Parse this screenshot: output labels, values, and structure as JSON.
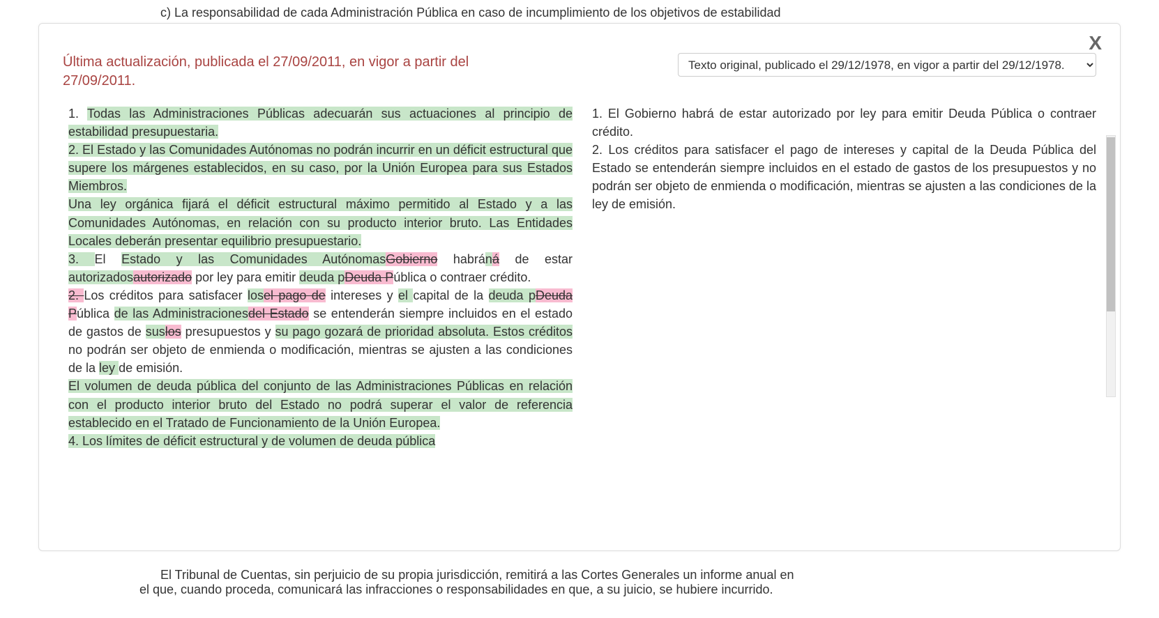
{
  "background": {
    "top_fragment": "c) La responsabilidad de cada Administración Pública en caso de incumplimiento de los objetivos de estabilidad",
    "bottom_fragment_line1": "El Tribunal de Cuentas, sin perjuicio de su propia jurisdicción, remitirá a las Cortes Generales un informe anual en",
    "bottom_fragment_line2": "el que, cuando proceda, comunicará las infracciones o responsabilidades en que, a su juicio, se hubiere incurrido."
  },
  "modal": {
    "close_label": "X",
    "left_title": "Última actualización, publicada el 27/09/2011, en vigor a partir del 27/09/2011.",
    "select_value": "Texto original, publicado el 29/12/1978, en vigor a partir del 29/12/1978.",
    "select_options": [
      "Texto original, publicado el 29/12/1978, en vigor a partir del 29/12/1978."
    ]
  },
  "left_panel": {
    "diff": [
      {
        "t": "plain",
        "v": "1. "
      },
      {
        "t": "ins",
        "v": "Todas las Administraciones Públicas adecuarán sus actuaciones al principio de estabilidad presupuestaria."
      },
      {
        "t": "br"
      },
      {
        "t": "ins",
        "v": "2. El Estado y las Comunidades Autónomas no podrán incurrir en un déficit estructural que supere los márgenes establecidos, en su caso, por la Unión Europea para sus Estados Miembros."
      },
      {
        "t": "br"
      },
      {
        "t": "ins",
        "v": "Una ley orgánica fijará el déficit estructural máximo permitido al Estado y a las Comunidades Autónomas, en relación con su producto interior bruto. Las Entidades Locales deberán presentar equilibrio presupuestario."
      },
      {
        "t": "br"
      },
      {
        "t": "ins",
        "v": "3. "
      },
      {
        "t": "plain",
        "v": "El "
      },
      {
        "t": "ins",
        "v": "Estado y las Comunidades Autónomas"
      },
      {
        "t": "del",
        "v": "Gobierno"
      },
      {
        "t": "plain",
        "v": " habrá"
      },
      {
        "t": "ins",
        "v": "n"
      },
      {
        "t": "del",
        "v": "á"
      },
      {
        "t": "plain",
        "v": " de estar "
      },
      {
        "t": "ins",
        "v": "autorizados"
      },
      {
        "t": "del",
        "v": "autorizado"
      },
      {
        "t": "plain",
        "v": " por ley para emitir "
      },
      {
        "t": "ins",
        "v": "deuda p"
      },
      {
        "t": "del",
        "v": "Deuda P"
      },
      {
        "t": "plain",
        "v": "ública o contraer crédito."
      },
      {
        "t": "br"
      },
      {
        "t": "del",
        "v": "2. "
      },
      {
        "t": "plain",
        "v": "Los créditos para satisfacer "
      },
      {
        "t": "ins",
        "v": "los"
      },
      {
        "t": "del",
        "v": "el pago de"
      },
      {
        "t": "plain",
        "v": " intereses y "
      },
      {
        "t": "ins",
        "v": "el "
      },
      {
        "t": "plain",
        "v": "capital de la "
      },
      {
        "t": "ins",
        "v": "deuda p"
      },
      {
        "t": "del",
        "v": "Deuda P"
      },
      {
        "t": "plain",
        "v": "ública "
      },
      {
        "t": "ins",
        "v": "de las Administraciones"
      },
      {
        "t": "del",
        "v": "del Estado"
      },
      {
        "t": "plain",
        "v": " se entenderán siempre incluidos en el estado de gastos de "
      },
      {
        "t": "ins",
        "v": "sus"
      },
      {
        "t": "del",
        "v": "los"
      },
      {
        "t": "plain",
        "v": " presupuestos y "
      },
      {
        "t": "ins",
        "v": "su pago gozará de prioridad absoluta. Estos créditos "
      },
      {
        "t": "plain",
        "v": "no podrán ser objeto de enmienda o modificación, mientras se ajusten a las condiciones de la "
      },
      {
        "t": "ins",
        "v": "ley "
      },
      {
        "t": "plain",
        "v": "de emisión."
      },
      {
        "t": "br"
      },
      {
        "t": "ins",
        "v": "El volumen de deuda pública del conjunto de las Administraciones Públicas en relación con el producto interior bruto del Estado no podrá superar el valor de referencia establecido en el Tratado de Funcionamiento de la Unión Europea."
      },
      {
        "t": "br"
      },
      {
        "t": "ins",
        "v": "4. Los límites de déficit estructural y de volumen de deuda pública"
      }
    ]
  },
  "right_panel": {
    "p1": "1. El Gobierno habrá de estar autorizado por ley para emitir Deuda Pública o contraer crédito.",
    "p2": "2. Los créditos para satisfacer el pago de intereses y capital de la Deuda Pública del Estado se entenderán siempre incluidos en el estado de gastos de los presupuestos y no podrán ser objeto de enmienda o modificación, mientras se ajusten a las condiciones de la ley de emisión."
  }
}
